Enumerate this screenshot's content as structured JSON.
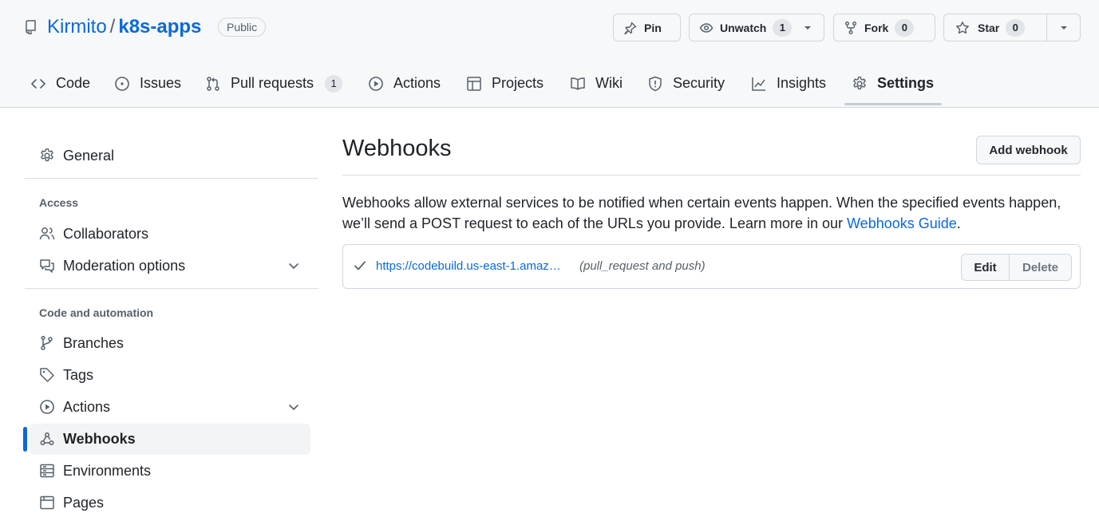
{
  "repo": {
    "owner": "Kirmito",
    "separator": "/",
    "name": "k8s-apps",
    "visibility": "Public"
  },
  "actions": {
    "pin_label": "Pin",
    "watch_label": "Unwatch",
    "watch_count": "1",
    "fork_label": "Fork",
    "fork_count": "0",
    "star_label": "Star",
    "star_count": "0"
  },
  "tabs": [
    {
      "label": "Code",
      "icon": "code-icon"
    },
    {
      "label": "Issues",
      "icon": "issue-opened-icon"
    },
    {
      "label": "Pull requests",
      "icon": "git-pull-request-icon",
      "count": "1"
    },
    {
      "label": "Actions",
      "icon": "play-icon"
    },
    {
      "label": "Projects",
      "icon": "table-icon"
    },
    {
      "label": "Wiki",
      "icon": "book-icon"
    },
    {
      "label": "Security",
      "icon": "shield-icon"
    },
    {
      "label": "Insights",
      "icon": "graph-icon"
    },
    {
      "label": "Settings",
      "icon": "gear-icon",
      "selected": true
    }
  ],
  "sidebar": {
    "general": "General",
    "access_heading": "Access",
    "collaborators": "Collaborators",
    "moderation": "Moderation options",
    "code_heading": "Code and automation",
    "branches": "Branches",
    "tags": "Tags",
    "actions": "Actions",
    "webhooks": "Webhooks",
    "environments": "Environments",
    "pages": "Pages"
  },
  "main": {
    "title": "Webhooks",
    "add_button": "Add webhook",
    "description": "Webhooks allow external services to be notified when certain events happen. When the specified events happen, we’ll send a POST request to each of the URLs you provide. Learn more in our ",
    "guide_link": "Webhooks Guide",
    "description_end": ".",
    "webhook": {
      "url": "https://codebuild.us-east-1.amaz…",
      "events": "(pull_request and push)",
      "status": "check-icon",
      "edit_label": "Edit",
      "delete_label": "Delete"
    }
  },
  "colors": {
    "accent": "#0969da",
    "header_bg": "#f6f8fa",
    "border": "#d0d7de"
  }
}
